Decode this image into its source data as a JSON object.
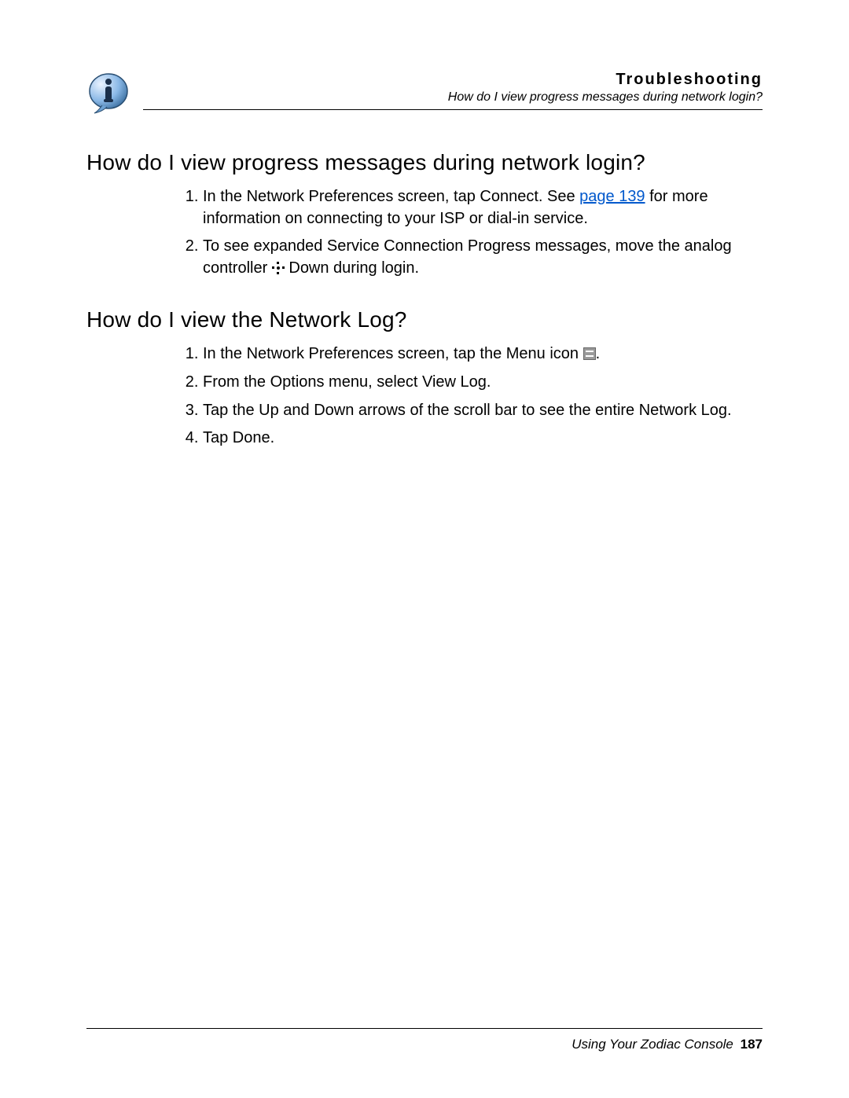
{
  "header": {
    "chapter": "Troubleshooting",
    "running": "How do I view progress messages during network login?"
  },
  "section1": {
    "title": "How do I view progress messages during network login?",
    "step1_a": "In the Network Preferences screen, tap Connect. See ",
    "step1_link": "page 139",
    "step1_b": " for more information on connecting to your ISP or dial-in service.",
    "step2_a": "To see expanded Service Connection Progress messages, move the analog controller ",
    "step2_b": " Down during login."
  },
  "section2": {
    "title": "How do I view the Network Log?",
    "step1_a": "In the Network Preferences screen, tap the Menu icon ",
    "step1_b": ".",
    "step2": "From the Options menu, select View Log.",
    "step3": "Tap the Up and Down arrows of the scroll bar to see the entire Network Log.",
    "step4": "Tap Done."
  },
  "footer": {
    "book": "Using Your Zodiac Console",
    "page": "187"
  }
}
